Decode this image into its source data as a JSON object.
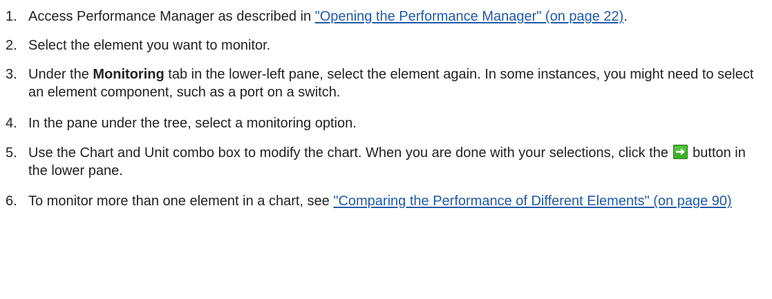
{
  "steps": [
    {
      "num": "1.",
      "text_before": "Access Performance Manager as described in ",
      "link_text": "\"Opening the Performance Manager\" (on page 22)",
      "text_after": "."
    },
    {
      "num": "2.",
      "text": "Select the element you want to monitor."
    },
    {
      "num": "3.",
      "text_before": "Under the ",
      "bold": "Monitoring",
      "text_after": " tab in the lower-left pane, select the element again. In some instances, you might need to select an element component, such as a port on a switch."
    },
    {
      "num": "4.",
      "text": "In the pane under the tree, select a monitoring option."
    },
    {
      "num": "5.",
      "text_before": "Use the Chart and Unit combo box to modify the chart. When you are done with your selections, click the ",
      "icon": "green-arrow-go-icon",
      "text_after": " button in the lower pane."
    },
    {
      "num": "6.",
      "text_before": "To monitor more than one element in a chart, see ",
      "link_text": "\"Comparing the Performance of Different Elements\" (on page 90)"
    }
  ],
  "colors": {
    "text": "#222222",
    "link": "#1e5aa8",
    "icon_green": "#3fae2a"
  }
}
